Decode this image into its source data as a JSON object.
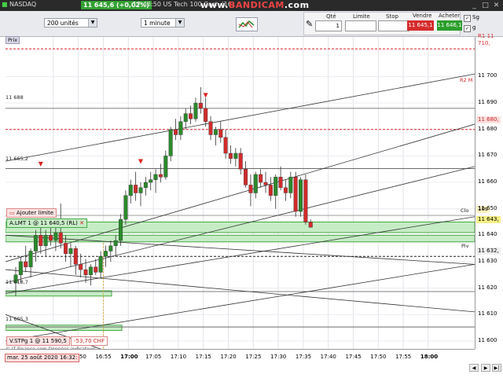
{
  "titlebar": {
    "instrument": "NASDAQ",
    "price": "11 645,6 (+0,02%)",
    "time_title": "17:43:50 US Tech 100 Cash (16)",
    "watermark_prefix": "www.",
    "watermark_brand": "BANDICAM",
    "watermark_suffix": ".com"
  },
  "toolbar": {
    "bars_select": "200 unités",
    "period_select": "1 minute"
  },
  "order_panel": {
    "qty_label": "Qté",
    "qty_value": "1",
    "limit_label": "Limite",
    "stop_label": "Stop",
    "sell_label": "Vendre",
    "buy_label": "Acheter",
    "sell_price": "11 645,1",
    "buy_price": "11 646,1",
    "check_sg": "Sg",
    "check_g": "g"
  },
  "chart": {
    "prix_tag": "Prix",
    "copyright": "© IT-Finance.com  Données indicatives",
    "date_label": "mar. 25 août 2020 16:32:",
    "add_limit_label": "Ajouter limite",
    "limit_order": "A.LMT 1 @ 11 640,5 (RL)",
    "stop_order": "V.STPg 1 @ 11 590,5",
    "stop_pnl": "-53,70 CHF",
    "hlines": [
      "11 688",
      "11 665,2",
      "11 618,7",
      "11 605,3"
    ],
    "y_ticks": [
      "11 700",
      "11 690",
      "11 680",
      "11 670",
      "11 660",
      "11 650",
      "11 640",
      "11 630",
      "11 620",
      "11 610",
      "11 600"
    ],
    "y_markers": {
      "r1": "R1",
      "r1_value": "11 710,",
      "r2": "R2 M",
      "r2_value": "11 680,",
      "clo": "Clo",
      "countdown": "10s",
      "last": "11 643,",
      "pv": "Piv",
      "pv_value": "11 632,"
    },
    "x_ticks": [
      "45",
      "16:50",
      "16:55",
      "17:00",
      "17:05",
      "17:10",
      "17:15",
      "17:20",
      "17:25",
      "17:30",
      "17:35",
      "17:40",
      "17:45",
      "17:50",
      "17:55",
      "18:00"
    ]
  },
  "colors": {
    "bull": "#2b8a2b",
    "bear": "#d22b2b",
    "zone": "#8fd18f"
  },
  "chart_data": {
    "type": "candlestick",
    "x": [
      "16:37",
      "16:38",
      "16:39",
      "16:40",
      "16:41",
      "16:42",
      "16:43",
      "16:44",
      "16:45",
      "16:46",
      "16:47",
      "16:48",
      "16:49",
      "16:50",
      "16:51",
      "16:52",
      "16:53",
      "16:54",
      "16:55",
      "16:56",
      "16:57",
      "16:58",
      "16:59",
      "17:00",
      "17:01",
      "17:02",
      "17:03",
      "17:04",
      "17:05",
      "17:06",
      "17:07",
      "17:08",
      "17:09",
      "17:10",
      "17:11",
      "17:12",
      "17:13",
      "17:14",
      "17:15",
      "17:16",
      "17:17",
      "17:18",
      "17:19",
      "17:20",
      "17:21",
      "17:22",
      "17:23",
      "17:24",
      "17:25",
      "17:26",
      "17:27",
      "17:28",
      "17:29",
      "17:30",
      "17:31",
      "17:32",
      "17:33",
      "17:34",
      "17:35",
      "17:36",
      "17:37",
      "17:38",
      "17:39",
      "17:40",
      "17:41",
      "17:42",
      "17:43"
    ],
    "ohlc": [
      [
        11622,
        11628,
        11617,
        11625
      ],
      [
        11625,
        11632,
        11622,
        11630
      ],
      [
        11630,
        11636,
        11626,
        11628
      ],
      [
        11628,
        11635,
        11624,
        11634
      ],
      [
        11634,
        11642,
        11630,
        11640
      ],
      [
        11640,
        11644,
        11633,
        11636
      ],
      [
        11636,
        11642,
        11632,
        11640
      ],
      [
        11640,
        11646,
        11636,
        11638
      ],
      [
        11638,
        11643,
        11634,
        11641
      ],
      [
        11641,
        11652,
        11635,
        11637
      ],
      [
        11637,
        11640,
        11630,
        11633
      ],
      [
        11633,
        11637,
        11628,
        11635
      ],
      [
        11635,
        11636,
        11625,
        11629
      ],
      [
        11629,
        11633,
        11624,
        11627
      ],
      [
        11627,
        11631,
        11622,
        11625
      ],
      [
        11625,
        11629,
        11621,
        11628
      ],
      [
        11628,
        11631,
        11625,
        11626
      ],
      [
        11626,
        11634,
        11624,
        11632
      ],
      [
        11632,
        11636,
        11628,
        11634
      ],
      [
        11634,
        11638,
        11630,
        11636
      ],
      [
        11636,
        11640,
        11632,
        11638
      ],
      [
        11638,
        11648,
        11636,
        11646
      ],
      [
        11646,
        11657,
        11644,
        11655
      ],
      [
        11655,
        11661,
        11652,
        11659
      ],
      [
        11659,
        11664,
        11653,
        11656
      ],
      [
        11656,
        11660,
        11651,
        11658
      ],
      [
        11658,
        11662,
        11655,
        11660
      ],
      [
        11660,
        11664,
        11657,
        11661
      ],
      [
        11661,
        11665,
        11656,
        11663
      ],
      [
        11663,
        11667,
        11660,
        11662
      ],
      [
        11662,
        11672,
        11661,
        11670
      ],
      [
        11670,
        11681,
        11668,
        11680
      ],
      [
        11680,
        11684,
        11676,
        11678
      ],
      [
        11678,
        11685,
        11676,
        11683
      ],
      [
        11683,
        11688,
        11680,
        11686
      ],
      [
        11686,
        11689,
        11682,
        11684
      ],
      [
        11684,
        11692,
        11683,
        11690
      ],
      [
        11690,
        11696,
        11686,
        11688
      ],
      [
        11688,
        11692,
        11681,
        11683
      ],
      [
        11683,
        11685,
        11676,
        11678
      ],
      [
        11678,
        11681,
        11674,
        11680
      ],
      [
        11680,
        11683,
        11675,
        11677
      ],
      [
        11677,
        11680,
        11669,
        11671
      ],
      [
        11671,
        11674,
        11667,
        11669
      ],
      [
        11669,
        11673,
        11666,
        11671
      ],
      [
        11671,
        11673,
        11663,
        11665
      ],
      [
        11665,
        11668,
        11658,
        11659
      ],
      [
        11659,
        11663,
        11651,
        11656
      ],
      [
        11656,
        11664,
        11654,
        11663
      ],
      [
        11663,
        11665,
        11658,
        11660
      ],
      [
        11660,
        11664,
        11656,
        11659
      ],
      [
        11659,
        11662,
        11653,
        11655
      ],
      [
        11655,
        11663,
        11650,
        11662
      ],
      [
        11662,
        11666,
        11657,
        11658
      ],
      [
        11658,
        11661,
        11653,
        11656
      ],
      [
        11656,
        11664,
        11654,
        11662
      ],
      [
        11662,
        11664,
        11647,
        11649
      ],
      [
        11649,
        11662,
        11647,
        11661
      ],
      [
        11661,
        11663,
        11644,
        11645
      ],
      [
        11645,
        11646,
        11643,
        11643
      ]
    ],
    "ylim": [
      11597,
      11715
    ]
  }
}
